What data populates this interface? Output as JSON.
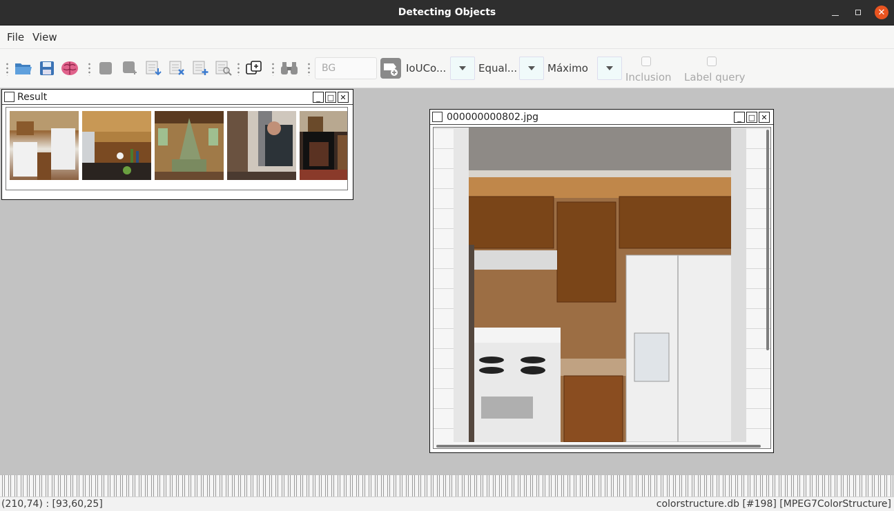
{
  "window": {
    "title": "Detecting Objects"
  },
  "menu": {
    "items": [
      "File",
      "View"
    ]
  },
  "toolbar": {
    "category_field": "BG",
    "dropdowns": [
      {
        "label": "IoUCo..."
      },
      {
        "label": "Equal..."
      },
      {
        "label": "Máximo"
      }
    ],
    "checkboxes": [
      {
        "label": "Inclusion",
        "checked": false
      },
      {
        "label": "Label query",
        "checked": false
      }
    ]
  },
  "result_window": {
    "title": "Result",
    "thumbnails": [
      {
        "name": "kitchen-white-appliances"
      },
      {
        "name": "kitchen-counter-bottles"
      },
      {
        "name": "bedroom-canopy-bed"
      },
      {
        "name": "men-bending-room"
      },
      {
        "name": "fireplace-living-room"
      }
    ]
  },
  "image_window": {
    "title": "000000000802.jpg"
  },
  "status": {
    "coords": "(210,74) : [93,60,25]",
    "info": "colorstructure.db [#198] [MPEG7ColorStructure]"
  }
}
